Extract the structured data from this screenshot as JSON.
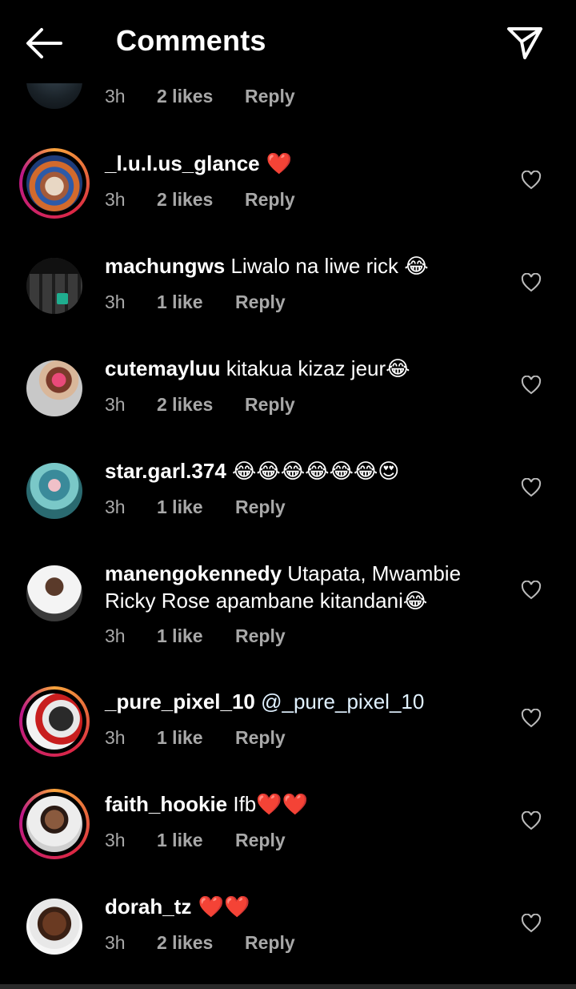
{
  "header": {
    "title": "Comments",
    "back_icon": "arrow-left-icon",
    "send_icon": "paper-plane-icon"
  },
  "top_partial": {
    "time": "3h",
    "likes": "2 likes",
    "reply": "Reply"
  },
  "comments": [
    {
      "username": "_l.u.l.us_glance",
      "text": " ❤️",
      "time": "3h",
      "likes": "2 likes",
      "reply": "Reply",
      "story_ring": true
    },
    {
      "username": "machungws",
      "text": " Liwalo na liwe rick 😂",
      "time": "3h",
      "likes": "1 like",
      "reply": "Reply",
      "story_ring": false
    },
    {
      "username": "cutemayluu",
      "text": " kitakua kizaz jeur😂",
      "time": "3h",
      "likes": "2 likes",
      "reply": "Reply",
      "story_ring": false
    },
    {
      "username": "star.garl.374",
      "text": " 😂😂😂😂😂😂😍",
      "time": "3h",
      "likes": "1 like",
      "reply": "Reply",
      "story_ring": false
    },
    {
      "username": "manengokennedy",
      "text": " Utapata, Mwambie Ricky Rose apambane kitandani😂",
      "time": "3h",
      "likes": "1 like",
      "reply": "Reply",
      "story_ring": false
    },
    {
      "username": "_pure_pixel_10",
      "text": " @_pure_pixel_10",
      "time": "3h",
      "likes": "1 like",
      "reply": "Reply",
      "story_ring": true
    },
    {
      "username": "faith_hookie",
      "text": " Ifb❤️❤️",
      "time": "3h",
      "likes": "1 like",
      "reply": "Reply",
      "story_ring": true
    },
    {
      "username": "dorah_tz",
      "text": " ❤️❤️",
      "time": "3h",
      "likes": "2 likes",
      "reply": "Reply",
      "story_ring": false
    }
  ],
  "colors": {
    "background": "#000000",
    "secondary_text": "#a8a8a8",
    "heart": "#e0183a",
    "ring": "#dc2743"
  }
}
